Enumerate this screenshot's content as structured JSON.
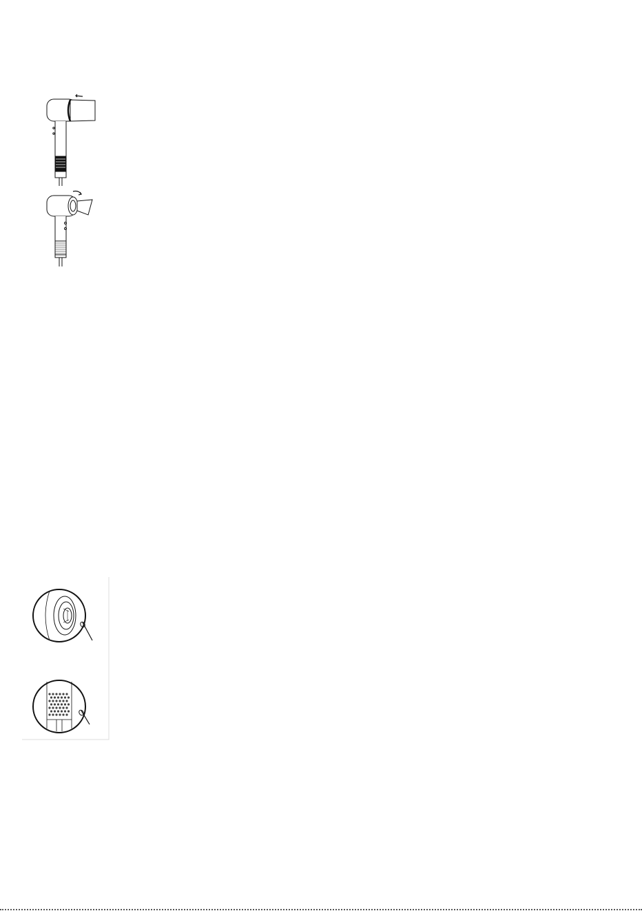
{
  "page": {
    "background": "#ffffff",
    "line_color": "#111111"
  },
  "figures": [
    {
      "icon": "hair-dryer-attach-nozzle-icon"
    },
    {
      "icon": "hair-dryer-rotate-nozzle-icon"
    },
    {
      "icon": "air-outlet-cleaning-detail-icon"
    },
    {
      "icon": "air-inlet-filter-cleaning-detail-icon"
    }
  ]
}
